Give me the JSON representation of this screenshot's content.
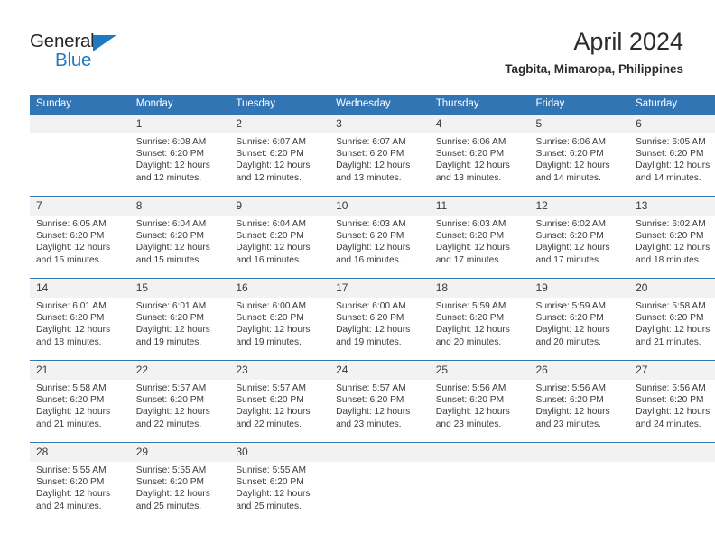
{
  "brand": {
    "name_part1": "General",
    "name_part2": "Blue",
    "accent_color": "#1f7ac4"
  },
  "header": {
    "title": "April 2024",
    "subtitle": "Tagbita, Mimaropa, Philippines",
    "header_bg_color": "#3175b5",
    "daynum_bg_color": "#f2f2f2"
  },
  "weekdays": [
    "Sunday",
    "Monday",
    "Tuesday",
    "Wednesday",
    "Thursday",
    "Friday",
    "Saturday"
  ],
  "labels": {
    "sunrise_prefix": "Sunrise:",
    "sunset_prefix": "Sunset:",
    "daylight_prefix": "Daylight:"
  },
  "weeks": [
    {
      "days": [
        {
          "num": "",
          "sunrise": "",
          "sunset": "",
          "daylight1": "",
          "daylight2": ""
        },
        {
          "num": "1",
          "sunrise": "Sunrise: 6:08 AM",
          "sunset": "Sunset: 6:20 PM",
          "daylight1": "Daylight: 12 hours",
          "daylight2": "and 12 minutes."
        },
        {
          "num": "2",
          "sunrise": "Sunrise: 6:07 AM",
          "sunset": "Sunset: 6:20 PM",
          "daylight1": "Daylight: 12 hours",
          "daylight2": "and 12 minutes."
        },
        {
          "num": "3",
          "sunrise": "Sunrise: 6:07 AM",
          "sunset": "Sunset: 6:20 PM",
          "daylight1": "Daylight: 12 hours",
          "daylight2": "and 13 minutes."
        },
        {
          "num": "4",
          "sunrise": "Sunrise: 6:06 AM",
          "sunset": "Sunset: 6:20 PM",
          "daylight1": "Daylight: 12 hours",
          "daylight2": "and 13 minutes."
        },
        {
          "num": "5",
          "sunrise": "Sunrise: 6:06 AM",
          "sunset": "Sunset: 6:20 PM",
          "daylight1": "Daylight: 12 hours",
          "daylight2": "and 14 minutes."
        },
        {
          "num": "6",
          "sunrise": "Sunrise: 6:05 AM",
          "sunset": "Sunset: 6:20 PM",
          "daylight1": "Daylight: 12 hours",
          "daylight2": "and 14 minutes."
        }
      ]
    },
    {
      "days": [
        {
          "num": "7",
          "sunrise": "Sunrise: 6:05 AM",
          "sunset": "Sunset: 6:20 PM",
          "daylight1": "Daylight: 12 hours",
          "daylight2": "and 15 minutes."
        },
        {
          "num": "8",
          "sunrise": "Sunrise: 6:04 AM",
          "sunset": "Sunset: 6:20 PM",
          "daylight1": "Daylight: 12 hours",
          "daylight2": "and 15 minutes."
        },
        {
          "num": "9",
          "sunrise": "Sunrise: 6:04 AM",
          "sunset": "Sunset: 6:20 PM",
          "daylight1": "Daylight: 12 hours",
          "daylight2": "and 16 minutes."
        },
        {
          "num": "10",
          "sunrise": "Sunrise: 6:03 AM",
          "sunset": "Sunset: 6:20 PM",
          "daylight1": "Daylight: 12 hours",
          "daylight2": "and 16 minutes."
        },
        {
          "num": "11",
          "sunrise": "Sunrise: 6:03 AM",
          "sunset": "Sunset: 6:20 PM",
          "daylight1": "Daylight: 12 hours",
          "daylight2": "and 17 minutes."
        },
        {
          "num": "12",
          "sunrise": "Sunrise: 6:02 AM",
          "sunset": "Sunset: 6:20 PM",
          "daylight1": "Daylight: 12 hours",
          "daylight2": "and 17 minutes."
        },
        {
          "num": "13",
          "sunrise": "Sunrise: 6:02 AM",
          "sunset": "Sunset: 6:20 PM",
          "daylight1": "Daylight: 12 hours",
          "daylight2": "and 18 minutes."
        }
      ]
    },
    {
      "days": [
        {
          "num": "14",
          "sunrise": "Sunrise: 6:01 AM",
          "sunset": "Sunset: 6:20 PM",
          "daylight1": "Daylight: 12 hours",
          "daylight2": "and 18 minutes."
        },
        {
          "num": "15",
          "sunrise": "Sunrise: 6:01 AM",
          "sunset": "Sunset: 6:20 PM",
          "daylight1": "Daylight: 12 hours",
          "daylight2": "and 19 minutes."
        },
        {
          "num": "16",
          "sunrise": "Sunrise: 6:00 AM",
          "sunset": "Sunset: 6:20 PM",
          "daylight1": "Daylight: 12 hours",
          "daylight2": "and 19 minutes."
        },
        {
          "num": "17",
          "sunrise": "Sunrise: 6:00 AM",
          "sunset": "Sunset: 6:20 PM",
          "daylight1": "Daylight: 12 hours",
          "daylight2": "and 19 minutes."
        },
        {
          "num": "18",
          "sunrise": "Sunrise: 5:59 AM",
          "sunset": "Sunset: 6:20 PM",
          "daylight1": "Daylight: 12 hours",
          "daylight2": "and 20 minutes."
        },
        {
          "num": "19",
          "sunrise": "Sunrise: 5:59 AM",
          "sunset": "Sunset: 6:20 PM",
          "daylight1": "Daylight: 12 hours",
          "daylight2": "and 20 minutes."
        },
        {
          "num": "20",
          "sunrise": "Sunrise: 5:58 AM",
          "sunset": "Sunset: 6:20 PM",
          "daylight1": "Daylight: 12 hours",
          "daylight2": "and 21 minutes."
        }
      ]
    },
    {
      "days": [
        {
          "num": "21",
          "sunrise": "Sunrise: 5:58 AM",
          "sunset": "Sunset: 6:20 PM",
          "daylight1": "Daylight: 12 hours",
          "daylight2": "and 21 minutes."
        },
        {
          "num": "22",
          "sunrise": "Sunrise: 5:57 AM",
          "sunset": "Sunset: 6:20 PM",
          "daylight1": "Daylight: 12 hours",
          "daylight2": "and 22 minutes."
        },
        {
          "num": "23",
          "sunrise": "Sunrise: 5:57 AM",
          "sunset": "Sunset: 6:20 PM",
          "daylight1": "Daylight: 12 hours",
          "daylight2": "and 22 minutes."
        },
        {
          "num": "24",
          "sunrise": "Sunrise: 5:57 AM",
          "sunset": "Sunset: 6:20 PM",
          "daylight1": "Daylight: 12 hours",
          "daylight2": "and 23 minutes."
        },
        {
          "num": "25",
          "sunrise": "Sunrise: 5:56 AM",
          "sunset": "Sunset: 6:20 PM",
          "daylight1": "Daylight: 12 hours",
          "daylight2": "and 23 minutes."
        },
        {
          "num": "26",
          "sunrise": "Sunrise: 5:56 AM",
          "sunset": "Sunset: 6:20 PM",
          "daylight1": "Daylight: 12 hours",
          "daylight2": "and 23 minutes."
        },
        {
          "num": "27",
          "sunrise": "Sunrise: 5:56 AM",
          "sunset": "Sunset: 6:20 PM",
          "daylight1": "Daylight: 12 hours",
          "daylight2": "and 24 minutes."
        }
      ]
    },
    {
      "days": [
        {
          "num": "28",
          "sunrise": "Sunrise: 5:55 AM",
          "sunset": "Sunset: 6:20 PM",
          "daylight1": "Daylight: 12 hours",
          "daylight2": "and 24 minutes."
        },
        {
          "num": "29",
          "sunrise": "Sunrise: 5:55 AM",
          "sunset": "Sunset: 6:20 PM",
          "daylight1": "Daylight: 12 hours",
          "daylight2": "and 25 minutes."
        },
        {
          "num": "30",
          "sunrise": "Sunrise: 5:55 AM",
          "sunset": "Sunset: 6:20 PM",
          "daylight1": "Daylight: 12 hours",
          "daylight2": "and 25 minutes."
        },
        {
          "num": "",
          "sunrise": "",
          "sunset": "",
          "daylight1": "",
          "daylight2": ""
        },
        {
          "num": "",
          "sunrise": "",
          "sunset": "",
          "daylight1": "",
          "daylight2": ""
        },
        {
          "num": "",
          "sunrise": "",
          "sunset": "",
          "daylight1": "",
          "daylight2": ""
        },
        {
          "num": "",
          "sunrise": "",
          "sunset": "",
          "daylight1": "",
          "daylight2": ""
        }
      ]
    }
  ]
}
